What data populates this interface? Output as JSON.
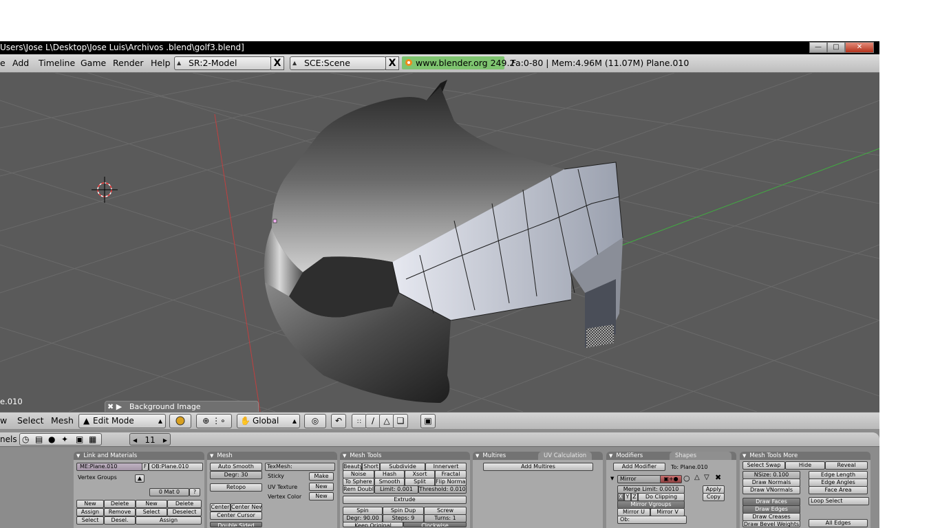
{
  "window": {
    "title": "Users\\Jose L\\Desktop\\Jose Luis\\Archivos .blend\\golf3.blend]",
    "controls": [
      "minimize-button",
      "maximize-button",
      "close-button"
    ]
  },
  "menubar": {
    "items": [
      "e",
      "Add",
      "Timeline",
      "Game",
      "Render",
      "Help"
    ],
    "screen": "SR:2-Model",
    "scene": "SCE:Scene",
    "url": "www.blender.org 249.2",
    "stats": "Fa:0-80 | Mem:4.96M (11.07M) Plane.010",
    "close_glyph": "X"
  },
  "viewport": {
    "object_name": "e.010",
    "background_image_label": "Background Image",
    "bg_icons": "✖ ▶"
  },
  "header3d": {
    "menus": [
      "w",
      "Select",
      "Mesh"
    ],
    "mode": "Edit Mode",
    "orientation": "Global",
    "mode_icon": "▲"
  },
  "buttons_header": {
    "label": "nels",
    "frame": "11",
    "left_arrow": "◀",
    "right_arrow": "▶"
  },
  "panels": {
    "link_materials": {
      "title": "Link and Materials",
      "me_field": "ME:Plane.010",
      "f_btn": "F",
      "ob_field": "OB:Plane.010",
      "vertex_groups": "Vertex Groups",
      "mat_field": "0 Mat 0",
      "q_btn": "?",
      "rows": [
        [
          "New",
          "Delete",
          "New",
          "Delete"
        ],
        [
          "Assign",
          "Remove",
          "Select",
          "Deselect"
        ],
        [
          "Select",
          "Desel.",
          "Assign"
        ]
      ]
    },
    "mesh": {
      "title": "Mesh",
      "auto_smooth": "Auto Smooth",
      "degr": "Degr: 30",
      "retopo": "Retopo",
      "center": "Center",
      "center_new": "Center New",
      "center_cursor": "Center Cursor",
      "double_sided": "Double Sided",
      "texmesh": "TexMesh:",
      "sticky": "Sticky",
      "uv_texture": "UV Texture",
      "vertex_color": "Vertex Color",
      "make": "Make",
      "new1": "New",
      "new2": "New"
    },
    "mesh_tools": {
      "title": "Mesh Tools",
      "row1": [
        "Beauty",
        "Short",
        "Subdivide",
        "Innervert"
      ],
      "row2": [
        "Noise",
        "Hash",
        "Xsort",
        "Fractal"
      ],
      "row3": [
        "To Sphere",
        "Smooth",
        "Split",
        "Flip Normal"
      ],
      "row4": [
        "Rem Doubl",
        "Limit: 0.001",
        "Threshold: 0.010"
      ],
      "extrude": "Extrude",
      "row5": [
        "Spin",
        "Spin Dup",
        "Screw"
      ],
      "row6": [
        "Degr: 90.00",
        "Steps: 9",
        "Turns: 1"
      ],
      "row7": [
        "Keep Original",
        "Clockwise"
      ]
    },
    "multires": {
      "tab1": "Multires",
      "tab2": "UV Calculation",
      "add": "Add Multires"
    },
    "modifiers": {
      "tab1": "Modifiers",
      "tab2": "Shapes",
      "add": "Add Modifier",
      "to": "To: Plane.010",
      "mirror": "Mirror",
      "merge_limit": "Merge Limit: 0.0010",
      "axes": [
        "X",
        "Y",
        "Z"
      ],
      "do_clipping": "Do Clipping",
      "mirror_vgroups": "Mirror Vgroups",
      "mirror_u": "Mirror U",
      "mirror_v": "Mirror V",
      "ob": "Ob:",
      "apply": "Apply",
      "copy": "Copy"
    },
    "mesh_tools_more": {
      "title": "Mesh Tools More",
      "row1": [
        "Select Swap",
        "Hide",
        "Reveal"
      ],
      "nsize": "NSize: 0.100",
      "draw_normals": "Draw Normals",
      "draw_vnormals": "Draw VNormals",
      "edge_length": "Edge Length",
      "edge_angles": "Edge Angles",
      "face_area": "Face Area",
      "draw_faces": "Draw Faces",
      "draw_edges": "Draw Edges",
      "draw_creases": "Draw Creases",
      "draw_bevel_weights": "Draw Bevel Weights",
      "loop_select": "Loop Select",
      "all_edges": "All Edges"
    }
  },
  "colors": {
    "viewport_bg": "#5a5a5a",
    "grid_line": "#6a6a6a",
    "x_axis": "#c04040",
    "y_axis": "#40b040",
    "url_bg": "#7ec46f"
  }
}
